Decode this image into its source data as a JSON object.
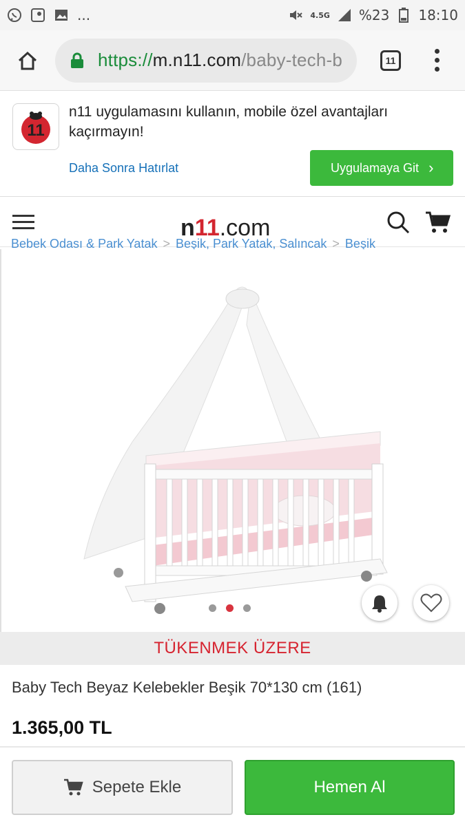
{
  "status_bar": {
    "network": "4.5G",
    "battery": "%23",
    "time": "18:10",
    "more": "..."
  },
  "browser": {
    "url_scheme": "https://",
    "url_host": "m.n11.com",
    "url_path": "/baby-tech-b",
    "tab_count": "11"
  },
  "app_banner": {
    "message": "n11 uygulamasını kullanın, mobile özel avantajları kaçırmayın!",
    "remind_later": "Daha Sonra Hatırlat",
    "open_app": "Uygulamaya Git",
    "logo_text": "11"
  },
  "site_header": {
    "logo_n": "n",
    "logo_11": "11",
    "logo_com": ".com"
  },
  "breadcrumb": {
    "items": [
      "Bebek Odası & Park Yatak",
      "Beşik, Park Yatak, Salıncak",
      "Beşik"
    ],
    "separator": ">"
  },
  "gallery": {
    "image_count": 3,
    "active_index": 1
  },
  "stock_status": "TÜKENMEK ÜZERE",
  "product": {
    "title": "Baby Tech Beyaz Kelebekler Beşik 70*130 cm (161)",
    "price": "1.365,00 TL"
  },
  "actions": {
    "add_to_cart": "Sepete Ekle",
    "buy_now": "Hemen Al"
  },
  "colors": {
    "brand_red": "#d32630",
    "action_green": "#3cb93c",
    "link_blue": "#1570b8"
  }
}
